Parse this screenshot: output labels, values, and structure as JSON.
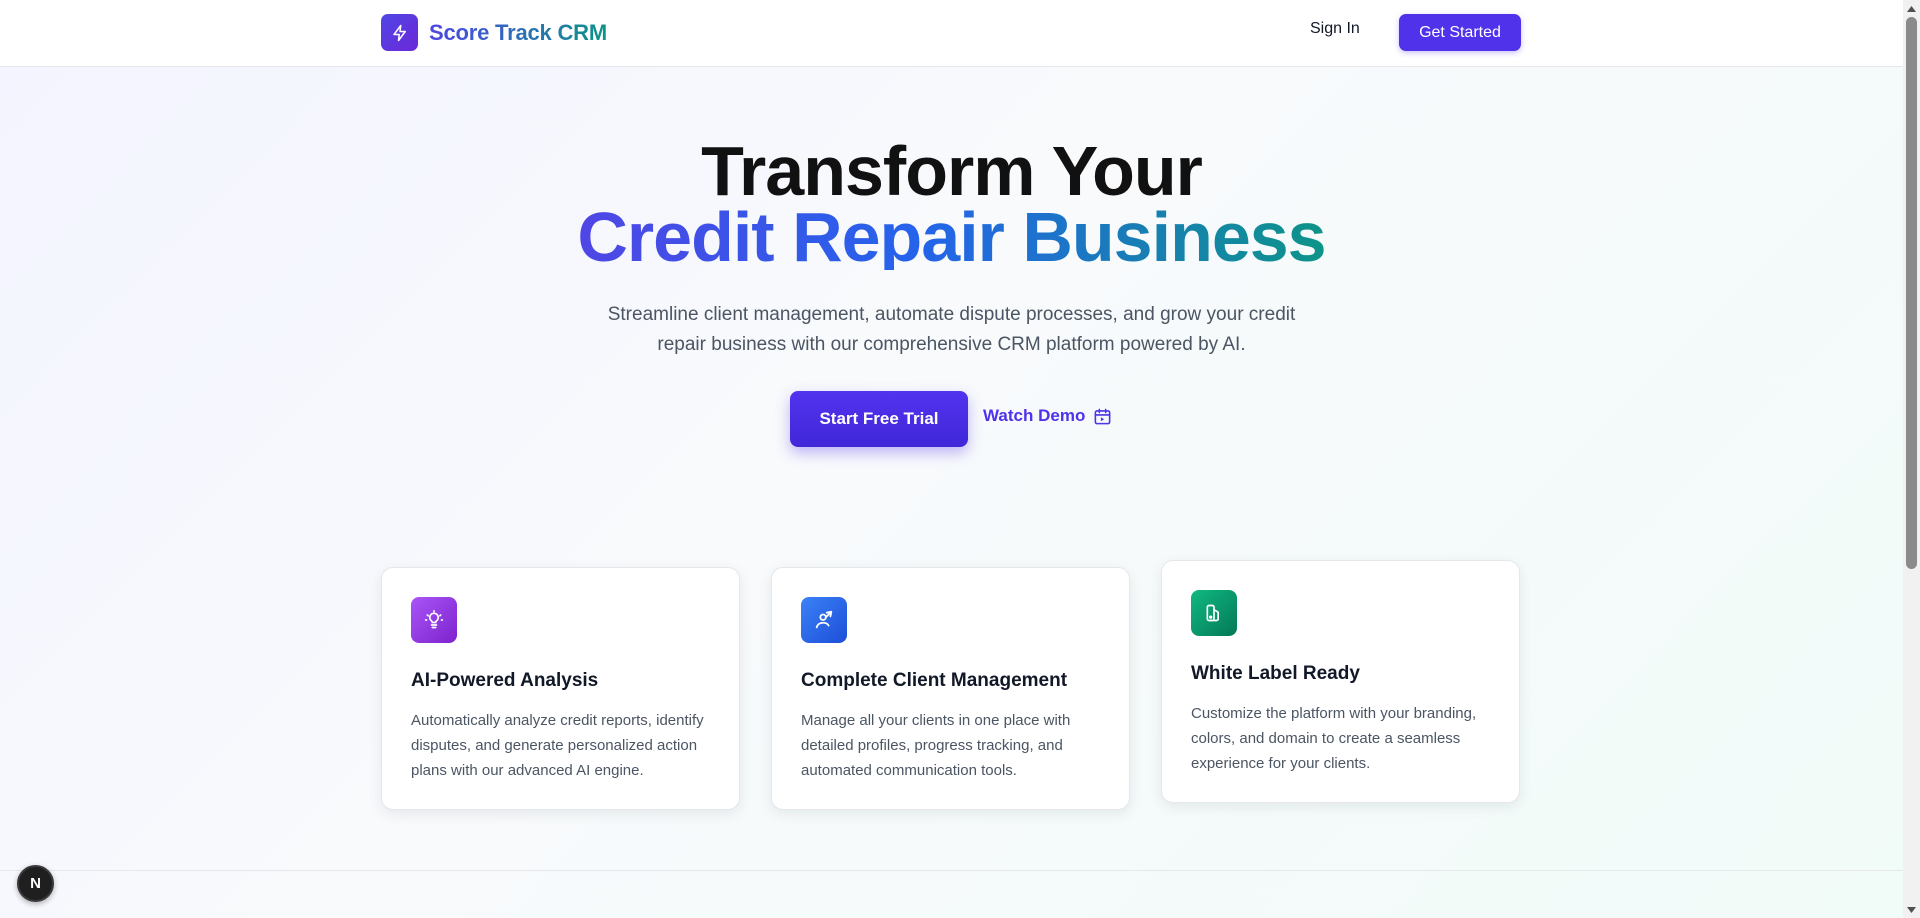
{
  "header": {
    "brand": "Score Track CRM",
    "logo_icon": "lightning-bolt-icon",
    "signin_label": "Sign In",
    "get_started_label": "Get Started"
  },
  "hero": {
    "title_line1": "Transform Your",
    "title_line2": "Credit Repair Business",
    "subtitle": "Streamline client management, automate dispute processes, and grow your credit repair business with our comprehensive CRM platform powered by AI.",
    "primary_cta": "Start Free Trial",
    "secondary_cta": "Watch Demo",
    "secondary_icon": "calendar-icon"
  },
  "features": [
    {
      "icon": "lightbulb-icon",
      "title": "AI-Powered Analysis",
      "description": "Automatically analyze credit reports, identify disputes, and generate personalized action plans with our advanced AI engine.",
      "icon_color": "#a855f7"
    },
    {
      "icon": "user-arrow-icon",
      "title": "Complete Client Management",
      "description": "Manage all your clients in one place with detailed profiles, progress tracking, and automated communication tools.",
      "icon_color": "#2563eb"
    },
    {
      "icon": "palette-icon",
      "title": "White Label Ready",
      "description": "Customize the platform with your branding, colors, and domain to create a seamless experience for your clients.",
      "icon_color": "#059669"
    }
  ],
  "dev_badge": {
    "label": "N"
  },
  "colors": {
    "accent": "#4f32ea",
    "brand_gradient_start": "#4f46e5",
    "brand_gradient_end": "#0d9488"
  }
}
